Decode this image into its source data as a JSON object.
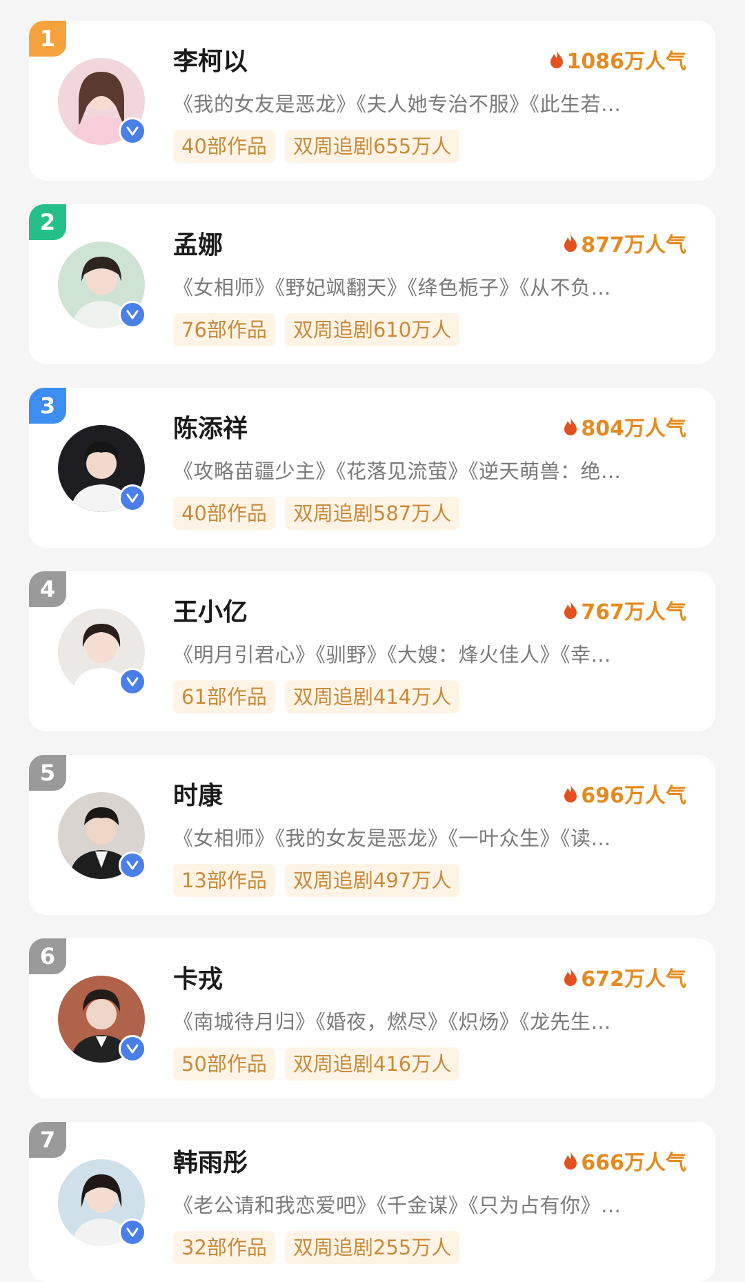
{
  "colors": {
    "rank_1": "#f5a23c",
    "rank_2": "#25c08a",
    "rank_3": "#3d8df2",
    "rank_other": "#9a9a9a",
    "popularity": "#e48a1e",
    "tag_bg": "#fdf4e6",
    "tag_text": "#c98a3a",
    "verified_badge": "#4a7fe8"
  },
  "icons": {
    "popularity": "fire-icon",
    "verified": "verified-v-icon"
  },
  "performers": [
    {
      "rank": "1",
      "name": "李柯以",
      "popularity": "1086万人气",
      "works": "《我的女友是恶龙》《夫人她专治不服》《此生若…",
      "works_count": "40部作品",
      "biweekly_viewers": "双周追剧655万人",
      "verified_label": "V"
    },
    {
      "rank": "2",
      "name": "孟娜",
      "popularity": "877万人气",
      "works": "《女相师》《野妃飒翻天》《绛色栀子》《从不负…",
      "works_count": "76部作品",
      "biweekly_viewers": "双周追剧610万人",
      "verified_label": "V"
    },
    {
      "rank": "3",
      "name": "陈添祥",
      "popularity": "804万人气",
      "works": "《攻略苗疆少主》《花落见流萤》《逆天萌兽：绝…",
      "works_count": "40部作品",
      "biweekly_viewers": "双周追剧587万人",
      "verified_label": "V"
    },
    {
      "rank": "4",
      "name": "王小亿",
      "popularity": "767万人气",
      "works": "《明月引君心》《驯野》《大嫂：烽火佳人》《幸…",
      "works_count": "61部作品",
      "biweekly_viewers": "双周追剧414万人",
      "verified_label": "V"
    },
    {
      "rank": "5",
      "name": "时康",
      "popularity": "696万人气",
      "works": "《女相师》《我的女友是恶龙》《一叶众生》《读…",
      "works_count": "13部作品",
      "biweekly_viewers": "双周追剧497万人",
      "verified_label": "V"
    },
    {
      "rank": "6",
      "name": "卡戎",
      "popularity": "672万人气",
      "works": "《南城待月归》《婚夜，燃尽》《炽炀》《龙先生…",
      "works_count": "50部作品",
      "biweekly_viewers": "双周追剧416万人",
      "verified_label": "V"
    },
    {
      "rank": "7",
      "name": "韩雨彤",
      "popularity": "666万人气",
      "works": "《老公请和我恋爱吧》《千金谋》《只为占有你》…",
      "works_count": "32部作品",
      "biweekly_viewers": "双周追剧255万人",
      "verified_label": "V"
    }
  ]
}
